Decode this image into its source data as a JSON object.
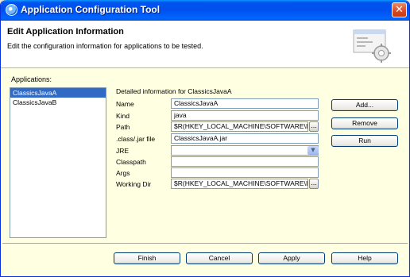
{
  "window": {
    "title": "Application Configuration Tool",
    "close_glyph": "✕"
  },
  "header": {
    "title": "Edit Application Information",
    "description": "Edit the configuration information for applications to be tested."
  },
  "apps": {
    "label": "Applications:",
    "items": [
      "ClassicsJavaA",
      "ClassicsJavaB"
    ],
    "selected": "ClassicsJavaA"
  },
  "details": {
    "title": "Detailed information for ClassicsJavaA",
    "fields": {
      "name": {
        "label": "Name",
        "value": "ClassicsJavaA"
      },
      "kind": {
        "label": "Kind",
        "value": "java"
      },
      "path": {
        "label": "Path",
        "value": "$R(HKEY_LOCAL_MACHINE\\SOFTWARE\\I"
      },
      "classjar": {
        "label": ".class/.jar file",
        "value": "ClassicsJavaA.jar"
      },
      "jre": {
        "label": "JRE",
        "value": ""
      },
      "classpath": {
        "label": "Classpath",
        "value": ""
      },
      "args": {
        "label": "Args",
        "value": ""
      },
      "workdir": {
        "label": "Working Dir",
        "value": "$R(HKEY_LOCAL_MACHINE\\SOFTWARE\\I"
      }
    },
    "browse_label": "..."
  },
  "actions": {
    "add": "Add...",
    "remove": "Remove",
    "run": "Run"
  },
  "footer": {
    "finish": "Finish",
    "cancel": "Cancel",
    "apply": "Apply",
    "help": "Help"
  },
  "icons": {
    "app": "app-globe-icon",
    "close": "close-icon",
    "header": "config-wizard-icon",
    "dropdown": "chevron-down-icon"
  },
  "colors": {
    "titlebar": "#0054e3",
    "selection": "#316ac5",
    "panel": "#ffffe1",
    "close": "#d84822"
  }
}
